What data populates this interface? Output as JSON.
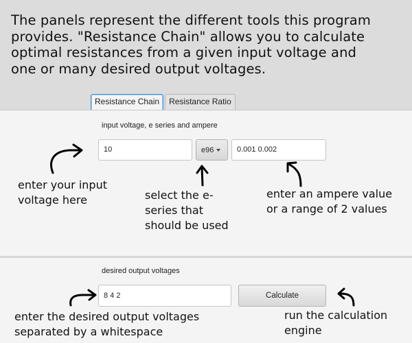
{
  "intro": {
    "lines": [
      "The panels represent the different tools this program",
      "provides. \"Resistance Chain\" allows you to calculate",
      "optimal resistances from a given input voltage and",
      "one or many desired output voltages."
    ]
  },
  "tabs": [
    {
      "label": "Resistance Chain",
      "active": true
    },
    {
      "label": "Resistance Ratio",
      "active": false
    }
  ],
  "panel_input": {
    "label": "input voltage, e series and ampere",
    "voltage_value": "10",
    "eseries_selected": "e96",
    "ampere_value": "0.001 0.002"
  },
  "panel_output": {
    "label": "desired output voltages",
    "voltages_value": "8 4 2",
    "calculate_label": "Calculate"
  },
  "hints": {
    "input_voltage": [
      "enter your input",
      "voltage here"
    ],
    "eseries": [
      "select the e-",
      "series that",
      "should be used"
    ],
    "ampere": [
      "enter an ampere value",
      "or a range of 2 values"
    ],
    "output_voltages": [
      "enter the desired output voltages",
      "separated by a whitespace"
    ],
    "calculate": [
      "run the calculation",
      "engine"
    ]
  },
  "icons": {
    "arrow_1": "curved-arrow-right-icon",
    "arrow_2": "arrow-up-icon",
    "arrow_3": "curved-arrow-up-left-icon",
    "arrow_4": "curved-arrow-right-icon",
    "arrow_5": "curved-arrow-left-icon"
  },
  "colors": {
    "intro_background": "#dcdcdc",
    "panel_background": "#f4f4f4",
    "tab_focus": "#3c8fd8"
  }
}
